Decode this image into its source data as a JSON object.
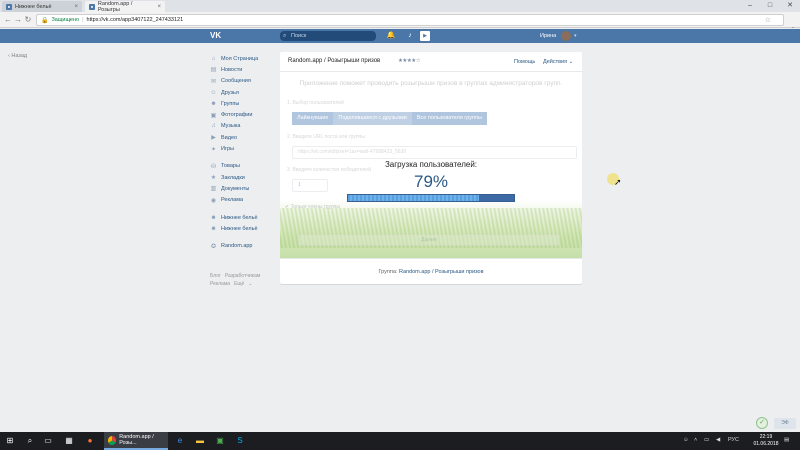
{
  "browser": {
    "tabs": [
      {
        "title": "Нижнее бельё",
        "active": false
      },
      {
        "title": "Random.app / Розыгры",
        "active": true
      }
    ],
    "secure_label": "Защищено",
    "url": "https://vk.com/app3407122_247433121"
  },
  "header": {
    "logo": "VK",
    "search_placeholder": "Поиск",
    "user_name": "Ирина"
  },
  "back_link": "Назад",
  "menu": {
    "items": [
      {
        "label": "Моя Страница",
        "icon": "home-icon"
      },
      {
        "label": "Новости",
        "icon": "news-icon"
      },
      {
        "label": "Сообщения",
        "icon": "messages-icon"
      },
      {
        "label": "Друзья",
        "icon": "friends-icon"
      },
      {
        "label": "Группы",
        "icon": "groups-icon"
      },
      {
        "label": "Фотографии",
        "icon": "photos-icon"
      },
      {
        "label": "Музыка",
        "icon": "music-icon"
      },
      {
        "label": "Видео",
        "icon": "video-icon"
      },
      {
        "label": "Игры",
        "icon": "games-icon"
      },
      {
        "label": "Товары",
        "icon": "goods-icon"
      },
      {
        "label": "Закладки",
        "icon": "bookmarks-icon"
      },
      {
        "label": "Документы",
        "icon": "documents-icon"
      },
      {
        "label": "Реклама",
        "icon": "ads-icon"
      },
      {
        "label": "Нижнее бельё",
        "icon": "group-icon"
      },
      {
        "label": "Нижнее бельё",
        "icon": "group-icon"
      },
      {
        "label": "Random.app",
        "icon": "app-icon"
      }
    ],
    "footer": [
      "Блог",
      "Разработчикам",
      "Реклама",
      "Ещё"
    ]
  },
  "app": {
    "title": "Random.app / Розыгрыши призов",
    "stars": "★★★★☆",
    "help": "Помощь",
    "actions": "Действия",
    "intro": "Приложение поможет проводить розыгрыши призов в группах администраторов групп.",
    "step1": "1. Выбор пользователей",
    "choices": [
      "Лайкнувшие",
      "Поделившиеся с друзьями",
      "Все пользователи группы"
    ],
    "step2": "2. Введите URL поста или группы",
    "url_placeholder": "https://vk.com/id/pixel=1ax=wall-47988433_5630",
    "step3": "3. Введите количество победителей",
    "winners_value": "1",
    "only_members": "Только члены группы",
    "next_button": "Далее",
    "loading_title": "Загрузка пользователей:",
    "percent_text": "79%",
    "progress": 0.79,
    "footer_prefix": "Группа:",
    "footer_link": "Random.app / Розыгрыши призов"
  },
  "bottom_right": {
    "button": "ЭФ"
  },
  "taskbar": {
    "app_title": "Random.app / Розы...",
    "lang": "РУС",
    "time": "22:19",
    "date": "01.06.2018"
  }
}
